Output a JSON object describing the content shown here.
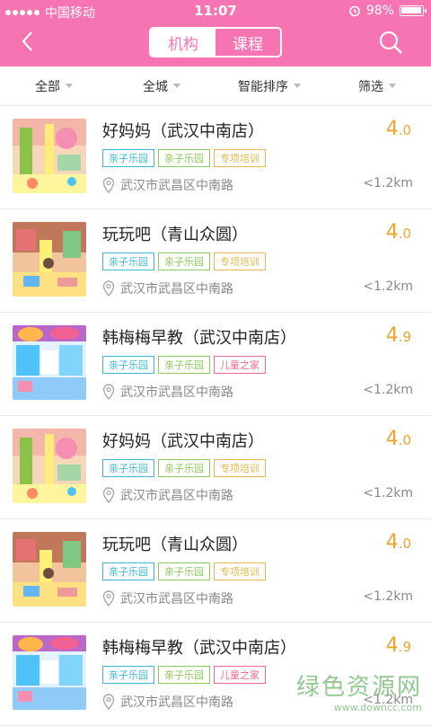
{
  "status_bar": {
    "carrier": "中国移动",
    "time": "11:07",
    "battery": "98%",
    "battery_level": 0.98
  },
  "nav": {
    "segments": [
      {
        "label": "机构",
        "active": true
      },
      {
        "label": "课程",
        "active": false
      }
    ],
    "back_icon": "chevron-left-icon",
    "search_icon": "search-icon"
  },
  "filters": [
    {
      "label": "全部"
    },
    {
      "label": "全城"
    },
    {
      "label": "智能排序"
    },
    {
      "label": "筛选"
    }
  ],
  "items": [
    {
      "name": "好妈妈（武汉中南店）",
      "rating_int": "4",
      "rating_dec": ".0",
      "tags": [
        "亲子乐园",
        "亲子乐园",
        "专项培训"
      ],
      "address": "武汉市武昌区中南路",
      "distance": "<1.2km",
      "thumb": "playground"
    },
    {
      "name": "玩玩吧（青山众圆）",
      "rating_int": "4",
      "rating_dec": ".0",
      "tags": [
        "亲子乐园",
        "亲子乐园",
        "专项培训"
      ],
      "address": "武汉市武昌区中南路",
      "distance": "<1.2km",
      "thumb": "playroom"
    },
    {
      "name": "韩梅梅早教（武汉中南店）",
      "rating_int": "4",
      "rating_dec": ".9",
      "tags": [
        "亲子乐园",
        "亲子乐园",
        "儿童之家"
      ],
      "address": "武汉市武昌区中南路",
      "distance": "<1.2km",
      "thumb": "classroom"
    },
    {
      "name": "好妈妈（武汉中南店）",
      "rating_int": "4",
      "rating_dec": ".0",
      "tags": [
        "亲子乐园",
        "亲子乐园",
        "专项培训"
      ],
      "address": "武汉市武昌区中南路",
      "distance": "<1.2km",
      "thumb": "playground"
    },
    {
      "name": "玩玩吧（青山众圆）",
      "rating_int": "4",
      "rating_dec": ".0",
      "tags": [
        "亲子乐园",
        "亲子乐园",
        "专项培训"
      ],
      "address": "武汉市武昌区中南路",
      "distance": "<1.2km",
      "thumb": "playroom"
    },
    {
      "name": "韩梅梅早教（武汉中南店）",
      "rating_int": "4",
      "rating_dec": ".9",
      "tags": [
        "亲子乐园",
        "亲子乐园",
        "儿童之家"
      ],
      "address": "武汉市武昌区中南路",
      "distance": "<1.2km",
      "thumb": "classroom"
    }
  ],
  "watermark": {
    "title": "绿色资源网",
    "url": "www.downcc.com"
  },
  "colors": {
    "brand": "#f774b2",
    "rating": "#f0a32a",
    "tag_blue": "#3db9d8",
    "tag_green": "#8fc75b",
    "tag_yellow": "#e6b84d",
    "tag_pink": "#ee6b8d"
  }
}
